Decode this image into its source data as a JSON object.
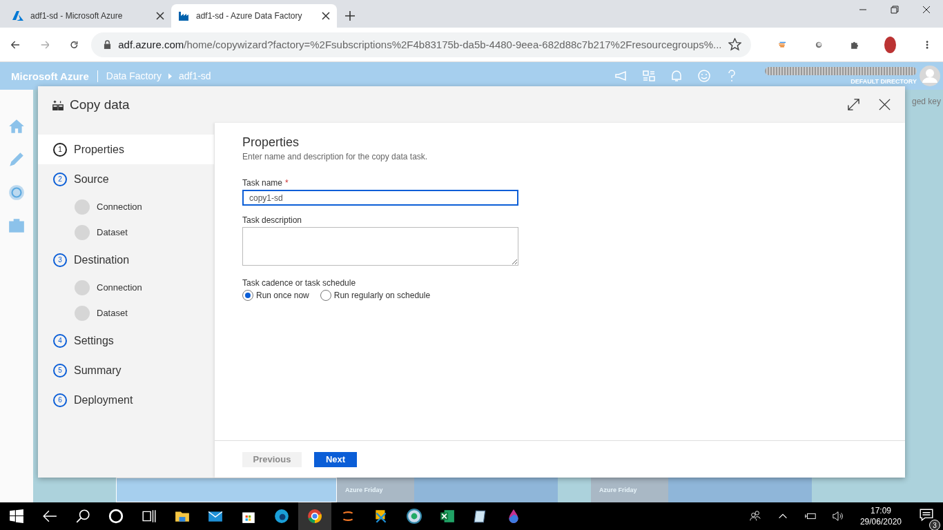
{
  "browser": {
    "tabs": [
      {
        "title": "adf1-sd - Microsoft Azure",
        "selected": false
      },
      {
        "title": "adf1-sd - Azure Data Factory",
        "selected": true
      }
    ],
    "address_host": "adf.azure.com",
    "address_path": "/home/copywizard?factory=%2Fsubscriptions%2F4b83175b-da5b-4480-9eea-682d88c7b217%2Fresourcegroups%..."
  },
  "portal_header": {
    "brand": "Microsoft Azure",
    "breadcrumb": [
      "Data Factory",
      "adf1-sd"
    ],
    "directory": "DEFAULT DIRECTORY"
  },
  "background": {
    "corner_text": "ged key",
    "tile_labels": [
      "Azure Friday",
      "Azure Friday"
    ]
  },
  "dialog": {
    "title": "Copy data",
    "steps": [
      {
        "number": "1",
        "label": "Properties",
        "selected": true
      },
      {
        "number": "2",
        "label": "Source",
        "selected": false,
        "substeps": [
          "Connection",
          "Dataset"
        ]
      },
      {
        "number": "3",
        "label": "Destination",
        "selected": false,
        "substeps": [
          "Connection",
          "Dataset"
        ]
      },
      {
        "number": "4",
        "label": "Settings",
        "selected": false
      },
      {
        "number": "5",
        "label": "Summary",
        "selected": false
      },
      {
        "number": "6",
        "label": "Deployment",
        "selected": false
      }
    ],
    "heading": "Properties",
    "subtitle": "Enter name and description for the copy data task.",
    "task_name": {
      "label": "Task name",
      "required_mark": "*",
      "value": "copy1-sd",
      "focused": true
    },
    "task_description": {
      "label": "Task description"
    },
    "cadence": {
      "label": "Task cadence or task schedule",
      "options": [
        {
          "label": "Run once now",
          "selected": true
        },
        {
          "label": "Run regularly on schedule",
          "selected": false
        }
      ]
    },
    "buttons": [
      {
        "label": "Previous",
        "disabled": true
      },
      {
        "label": "Next",
        "disabled": false
      }
    ]
  },
  "taskbar": {
    "time": "17:09",
    "date": "29/06/2020",
    "notifications": "3"
  }
}
